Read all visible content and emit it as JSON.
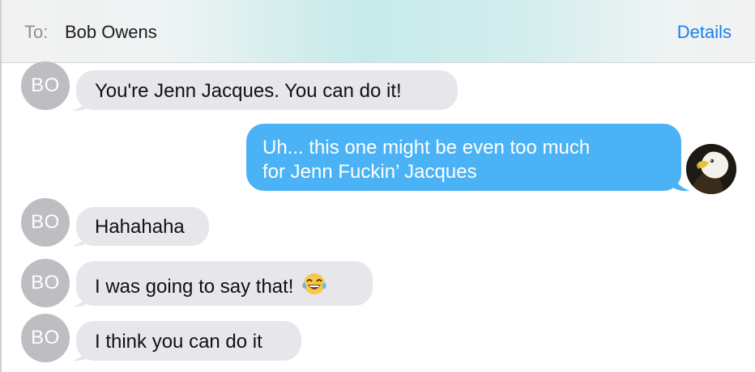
{
  "header": {
    "to_label": "To:",
    "recipient": "Bob Owens",
    "details_label": "Details"
  },
  "colors": {
    "incoming_bubble": "#e6e6eb",
    "outgoing_bubble": "#4bb3f5",
    "avatar_gray": "#bdbdc2",
    "link_blue": "#1b7cf2"
  },
  "messages": [
    {
      "from": "BO",
      "text": "You're Jenn Jacques. You can do it!"
    },
    {
      "from": "me",
      "line1": "Uh... this one might be even too much",
      "line2": "for Jenn Fuckin’ Jacques"
    },
    {
      "from": "BO",
      "text": "Hahahaha"
    },
    {
      "from": "BO",
      "text": "I was going to say that!",
      "emoji": "😂"
    },
    {
      "from": "BO",
      "text": "I think you can do it"
    }
  ]
}
